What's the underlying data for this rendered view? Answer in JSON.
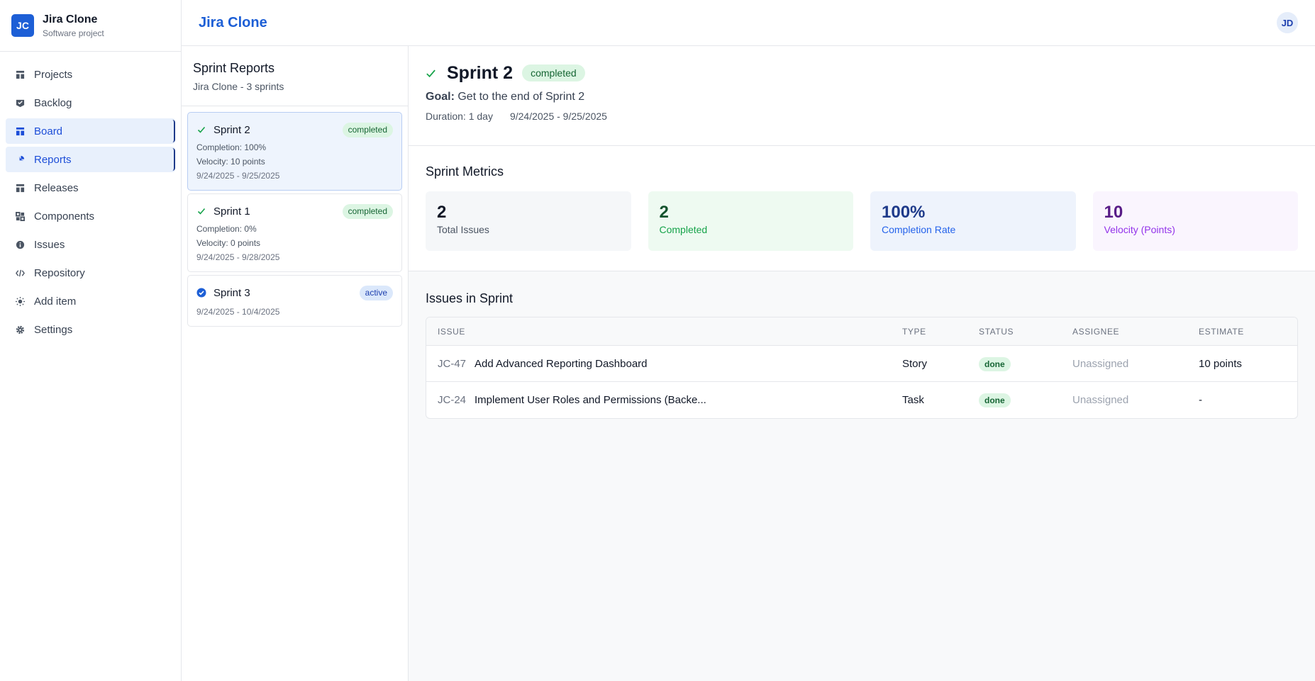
{
  "sidebar": {
    "logo_text": "JC",
    "project_name": "Jira Clone",
    "project_type": "Software project",
    "items": [
      {
        "label": "Projects",
        "icon": "board-icon"
      },
      {
        "label": "Backlog",
        "icon": "backlog-icon"
      },
      {
        "label": "Board",
        "icon": "board-icon",
        "active": true
      },
      {
        "label": "Reports",
        "icon": "chart-icon",
        "active": true
      },
      {
        "label": "Releases",
        "icon": "release-icon"
      },
      {
        "label": "Components",
        "icon": "components-icon"
      },
      {
        "label": "Issues",
        "icon": "info-icon"
      },
      {
        "label": "Repository",
        "icon": "code-icon"
      },
      {
        "label": "Add item",
        "icon": "sun-icon"
      },
      {
        "label": "Settings",
        "icon": "gear-icon"
      }
    ]
  },
  "header": {
    "title": "Jira Clone",
    "user_initials": "JD"
  },
  "sprint_panel": {
    "title": "Sprint Reports",
    "subtitle": "Jira Clone - 3 sprints",
    "sprints": [
      {
        "name": "Sprint 2",
        "status": "completed",
        "completion": "Completion: 100%",
        "velocity": "Velocity: 10 points",
        "dates": "9/24/2025 - 9/25/2025"
      },
      {
        "name": "Sprint 1",
        "status": "completed",
        "completion": "Completion: 0%",
        "velocity": "Velocity: 0 points",
        "dates": "9/24/2025 - 9/28/2025"
      },
      {
        "name": "Sprint 3",
        "status": "active",
        "dates": "9/24/2025 - 10/4/2025"
      }
    ]
  },
  "detail": {
    "title": "Sprint 2",
    "status": "completed",
    "goal_label": "Goal:",
    "goal": "Get to the end of Sprint 2",
    "duration": "Duration: 1 day",
    "dates": "9/24/2025 - 9/25/2025",
    "metrics_title": "Sprint Metrics",
    "metrics": [
      {
        "value": "2",
        "label": "Total Issues"
      },
      {
        "value": "2",
        "label": "Completed"
      },
      {
        "value": "100%",
        "label": "Completion Rate"
      },
      {
        "value": "10",
        "label": "Velocity (Points)"
      }
    ],
    "issues_title": "Issues in Sprint",
    "columns": [
      "ISSUE",
      "TYPE",
      "STATUS",
      "ASSIGNEE",
      "ESTIMATE"
    ],
    "issues": [
      {
        "key": "JC-47",
        "summary": "Add Advanced Reporting Dashboard",
        "type": "Story",
        "status": "done",
        "assignee": "Unassigned",
        "estimate": "10 points"
      },
      {
        "key": "JC-24",
        "summary": "Implement User Roles and Permissions (Backe...",
        "type": "Task",
        "status": "done",
        "assignee": "Unassigned",
        "estimate": "-"
      }
    ]
  },
  "colors": {
    "brand": "#1d5fd6",
    "done": "#166534",
    "active": "#1e40af"
  }
}
